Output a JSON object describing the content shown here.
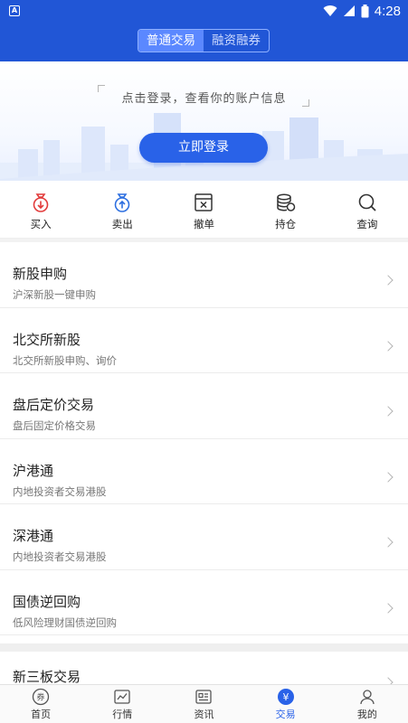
{
  "status_bar": {
    "time": "4:28"
  },
  "header": {
    "tabs": [
      {
        "label": "普通交易",
        "active": true
      },
      {
        "label": "融资融券",
        "active": false
      }
    ]
  },
  "login_banner": {
    "prompt": "点击登录，查看你的账户信息",
    "button_label": "立即登录"
  },
  "quick_actions": [
    {
      "label": "买入",
      "icon": "buy-icon",
      "color": "#e23b3b"
    },
    {
      "label": "卖出",
      "icon": "sell-icon",
      "color": "#2d6fe0"
    },
    {
      "label": "撤单",
      "icon": "cancel-order-icon",
      "color": "#333333"
    },
    {
      "label": "持仓",
      "icon": "holdings-icon",
      "color": "#333333"
    },
    {
      "label": "查询",
      "icon": "search-icon",
      "color": "#333333"
    }
  ],
  "menu": [
    {
      "title": "新股申购",
      "subtitle": "沪深新股一键申购"
    },
    {
      "title": "北交所新股",
      "subtitle": "北交所新股申购、询价"
    },
    {
      "title": "盘后定价交易",
      "subtitle": "盘后固定价格交易"
    },
    {
      "title": "沪港通",
      "subtitle": "内地投资者交易港股"
    },
    {
      "title": "深港通",
      "subtitle": "内地投资者交易港股"
    },
    {
      "title": "国债逆回购",
      "subtitle": "低风险理财国债逆回购"
    }
  ],
  "menu_partial": {
    "title": "新三板交易"
  },
  "bottom_nav": [
    {
      "label": "首页",
      "icon": "home-icon",
      "active": false
    },
    {
      "label": "行情",
      "icon": "market-icon",
      "active": false
    },
    {
      "label": "资讯",
      "icon": "news-icon",
      "active": false
    },
    {
      "label": "交易",
      "icon": "trade-icon",
      "active": true
    },
    {
      "label": "我的",
      "icon": "profile-icon",
      "active": false
    }
  ],
  "colors": {
    "primary": "#2156d6",
    "accent": "#2962e8",
    "buy": "#e23b3b"
  }
}
